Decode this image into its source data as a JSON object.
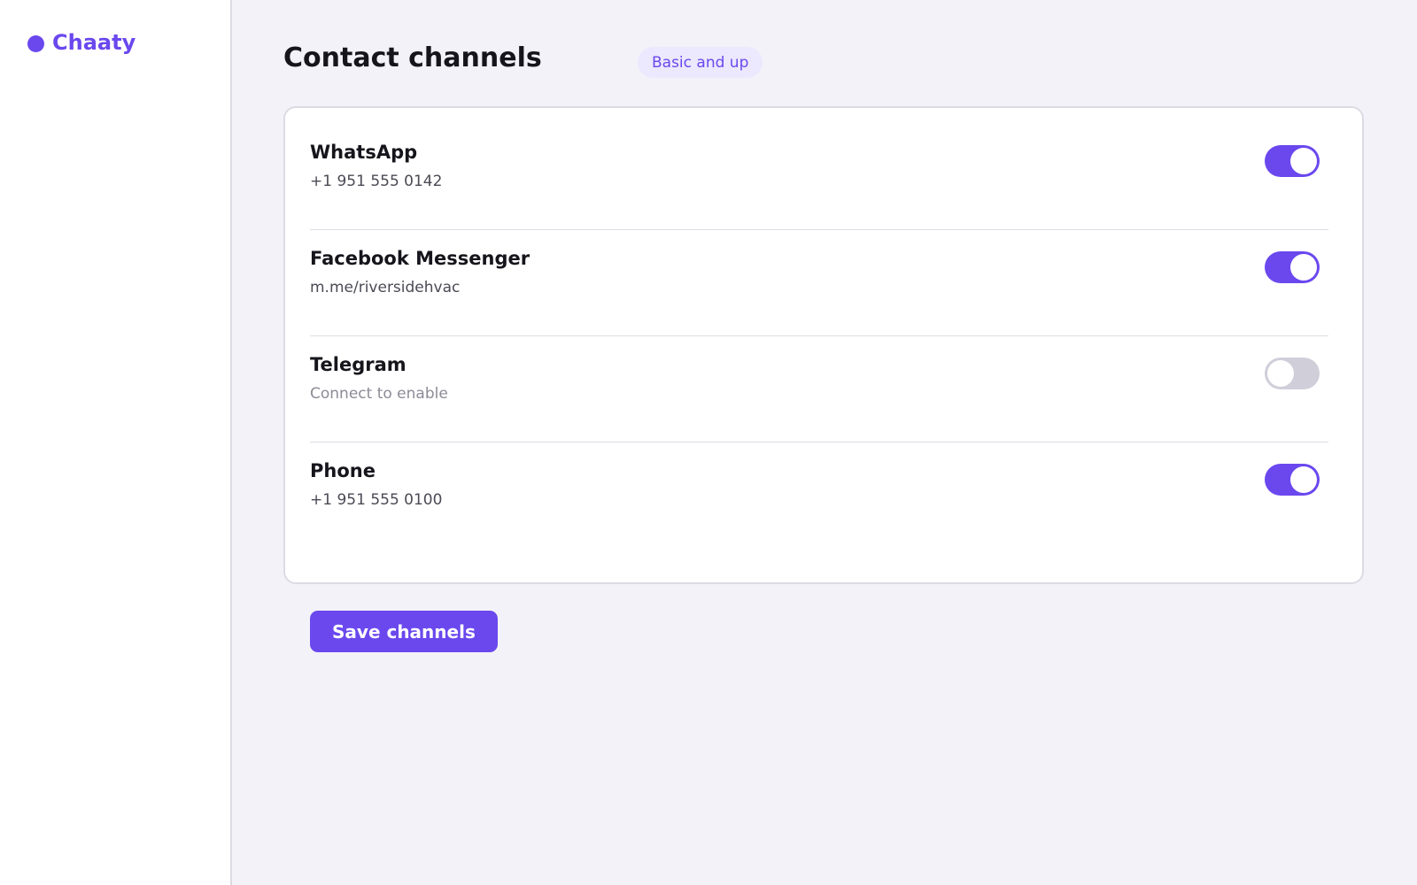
{
  "sidebar": {
    "brand": "Chaaty"
  },
  "header": {
    "title": "Contact channels",
    "plan_badge": "Basic and up"
  },
  "channels": [
    {
      "name": "WhatsApp",
      "detail": "+1 951 555 0142",
      "enabled": true
    },
    {
      "name": "Facebook Messenger",
      "detail": "m.me/riversidehvac",
      "enabled": true
    },
    {
      "name": "Telegram",
      "detail": "Connect to enable",
      "enabled": false
    },
    {
      "name": "Phone",
      "detail": "+1 951 555 0100",
      "enabled": true
    }
  ],
  "actions": {
    "save_label": "Save channels"
  },
  "colors": {
    "accent": "#6a48ee",
    "toggle_off": "#cfced9",
    "badge_bg": "#ece8fd"
  }
}
